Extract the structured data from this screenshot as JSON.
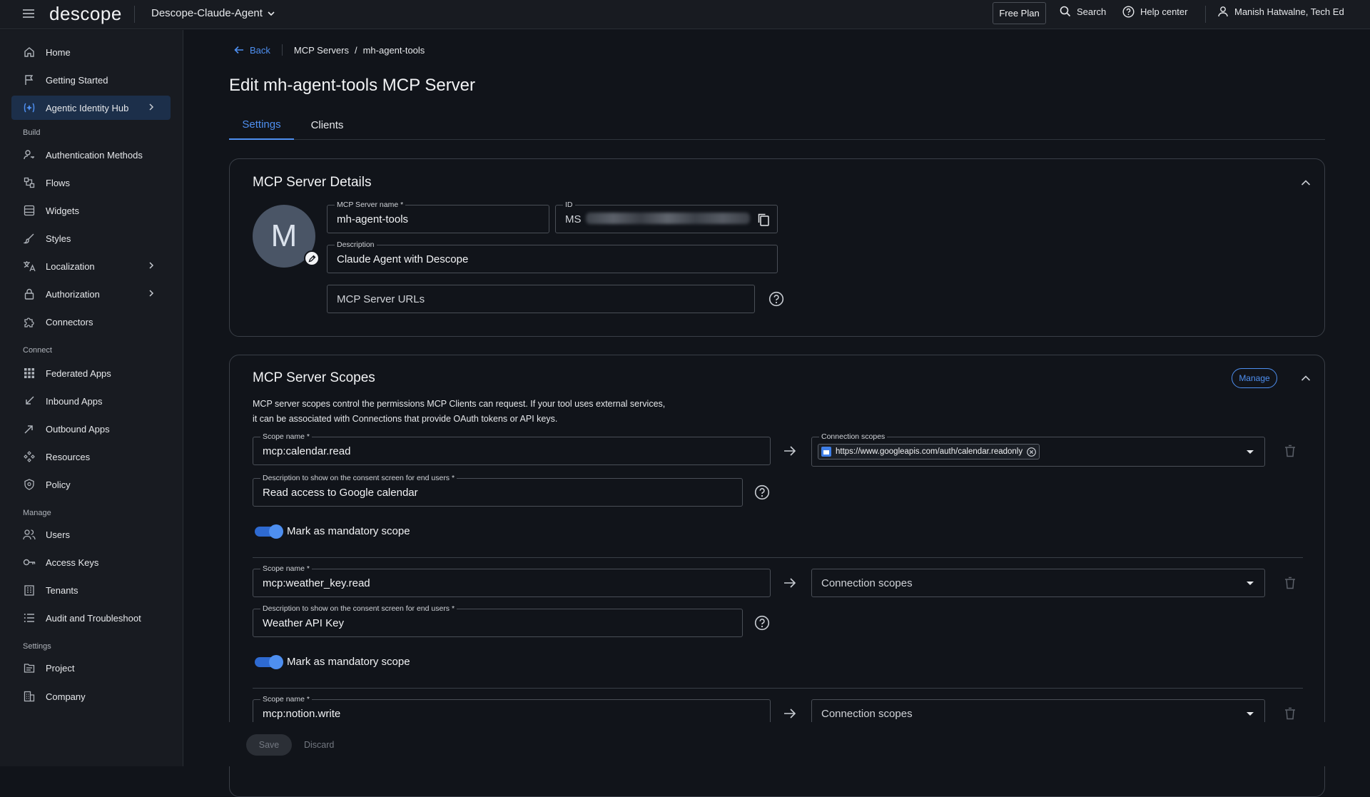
{
  "topbar": {
    "logo": "descope",
    "project": "Descope-Claude-Agent",
    "free_plan": "Free Plan",
    "search": "Search",
    "help": "Help center",
    "user": "Manish Hatwalne, Tech Ed"
  },
  "sidebar": {
    "home": "Home",
    "getting_started": "Getting Started",
    "agentic": "Agentic Identity Hub",
    "section_build": "Build",
    "auth_methods": "Authentication Methods",
    "flows": "Flows",
    "widgets": "Widgets",
    "styles": "Styles",
    "localization": "Localization",
    "authorization": "Authorization",
    "connectors": "Connectors",
    "section_connect": "Connect",
    "federated": "Federated Apps",
    "inbound": "Inbound Apps",
    "outbound": "Outbound Apps",
    "resources": "Resources",
    "policy": "Policy",
    "section_manage": "Manage",
    "users": "Users",
    "access_keys": "Access Keys",
    "tenants": "Tenants",
    "audit": "Audit and Troubleshoot",
    "section_settings": "Settings",
    "project": "Project",
    "company": "Company"
  },
  "breadcrumb": {
    "back": "Back",
    "parent": "MCP Servers",
    "separator": "/",
    "current": "mh-agent-tools"
  },
  "page_title": "Edit mh-agent-tools MCP Server",
  "tabs": {
    "settings": "Settings",
    "clients": "Clients"
  },
  "details": {
    "title": "MCP Server Details",
    "avatar_letter": "M",
    "name_label": "MCP Server name *",
    "name_value": "mh-agent-tools",
    "id_label": "ID",
    "id_prefix": "MS",
    "description_label": "Description",
    "description_value": "Claude Agent with Descope",
    "urls_placeholder": "MCP Server URLs"
  },
  "scopes": {
    "title": "MCP Server Scopes",
    "manage": "Manage",
    "description_line1": "MCP server scopes control the permissions MCP Clients can request. If your tool uses external services,",
    "description_line2": "it can be associated with Connections that provide OAuth tokens or API keys.",
    "scope_name_label": "Scope name *",
    "consent_label": "Description to show on the consent screen for end users *",
    "connection_label": "Connection scopes",
    "mandatory_label": "Mark as mandatory scope",
    "items": [
      {
        "name": "mcp:calendar.read",
        "description": "Read access to Google calendar",
        "connection": "https://www.googleapis.com/auth/calendar.readonly",
        "mandatory": true
      },
      {
        "name": "mcp:weather_key.read",
        "description": "Weather API Key",
        "connection": "",
        "mandatory": true
      },
      {
        "name": "mcp:notion.write",
        "description": "",
        "connection": "",
        "mandatory": true
      }
    ]
  },
  "footer": {
    "save": "Save",
    "discard": "Discard"
  },
  "colors": {
    "accent": "#4e8ff0",
    "background": "#11141a",
    "panel": "#181b21"
  }
}
